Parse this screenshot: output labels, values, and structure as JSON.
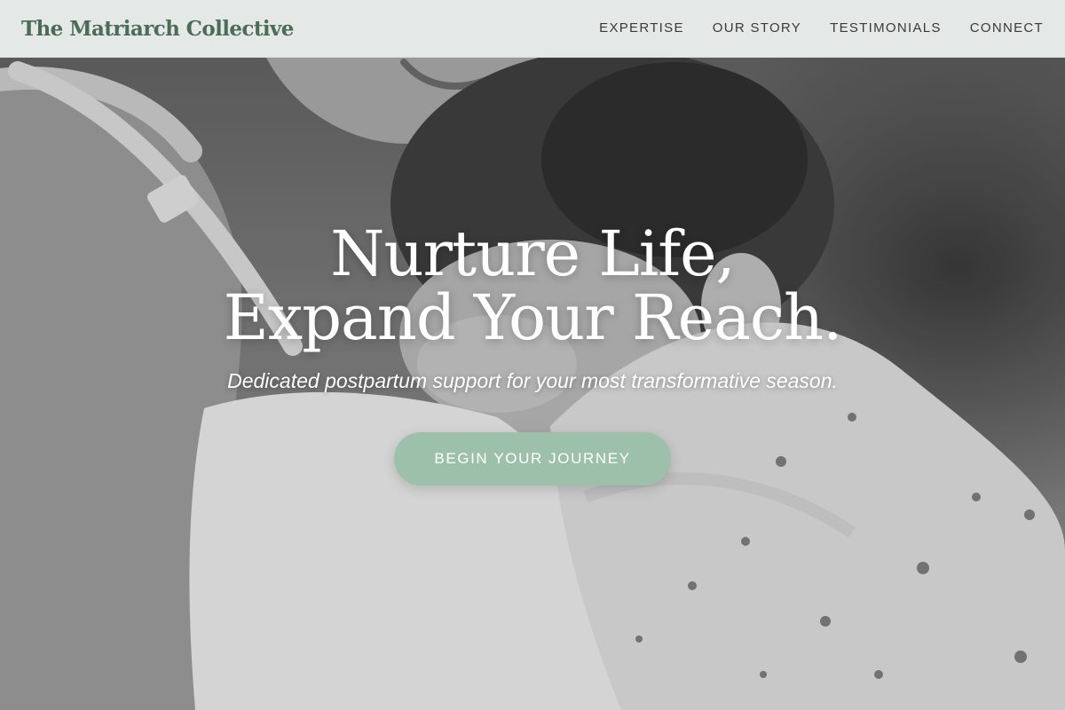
{
  "header": {
    "brand": "The Matriarch Collective",
    "nav": [
      {
        "label": "EXPERTISE"
      },
      {
        "label": "OUR STORY"
      },
      {
        "label": "TESTIMONIALS"
      },
      {
        "label": "CONNECT"
      }
    ]
  },
  "hero": {
    "headline_line1": "Nurture Life,",
    "headline_line2": "Expand Your Reach.",
    "subtitle": "Dedicated postpartum support for your most transformative season.",
    "cta_label": "BEGIN YOUR JOURNEY",
    "image_alt": "Black and white photo of a mother holding a sleeping newborn against her shoulder"
  },
  "colors": {
    "brand": "#4d6b59",
    "accent": "#9dc0aa",
    "header_bg": "#ecf0ee",
    "nav_text": "#3a3a3a"
  }
}
